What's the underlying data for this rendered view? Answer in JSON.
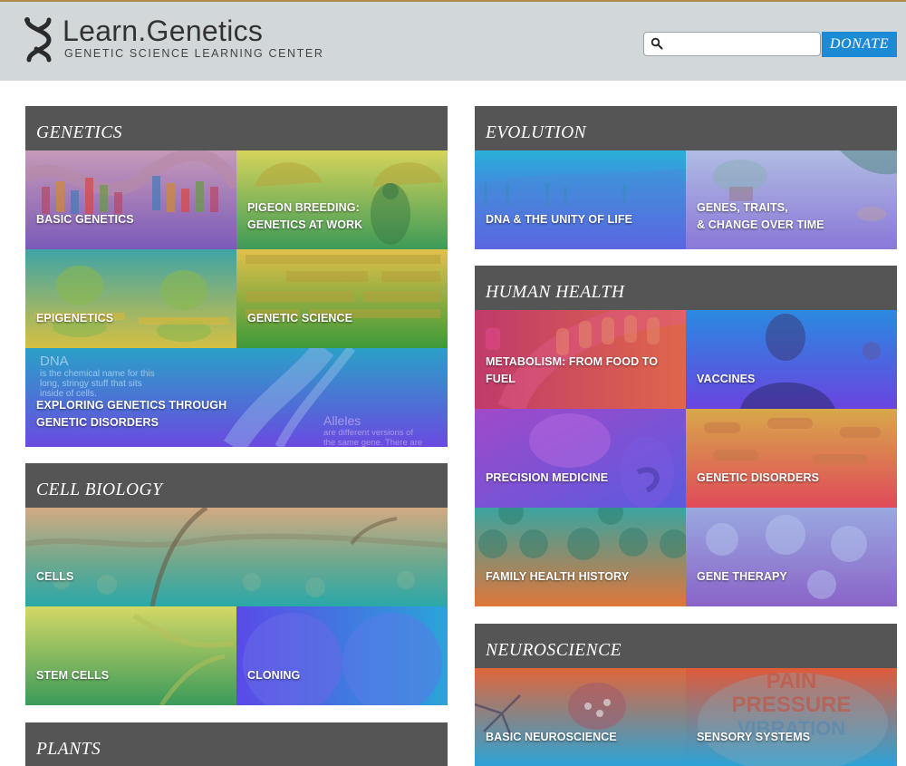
{
  "header": {
    "title": "Learn.Genetics",
    "subtitle": "GENETIC SCIENCE LEARNING CENTER",
    "search_placeholder": "",
    "search_icon": "search-icon",
    "donate_label": "DONATE",
    "colors": {
      "header_bg": "#d2d8da",
      "donate_bg": "#1d8ad6",
      "section_head_bg": "#555555"
    }
  },
  "sections": {
    "genetics": {
      "title": "GENETICS",
      "tiles": [
        {
          "line1": "BASIC GENETICS"
        },
        {
          "line1": "PIGEON BREEDING:",
          "line2": "GENETICS AT WORK"
        },
        {
          "line1": "EPIGENETICS"
        },
        {
          "line1": "GENETIC SCIENCE"
        },
        {
          "line1": "EXPLORING GENETICS THROUGH",
          "line2": "GENETIC DISORDERS",
          "art_text": {
            "dna_title": "DNA",
            "dna_line1": "is the chemical name for this",
            "dna_line2": "long, stringy stuff that sits",
            "dna_line3": "inside of cells.",
            "alleles_title": "Alleles",
            "alleles_line1": "are different versions of",
            "alleles_line2": "the same gene. There are"
          }
        }
      ]
    },
    "cell_biology": {
      "title": "CELL BIOLOGY",
      "tiles": [
        {
          "line1": "CELLS"
        },
        {
          "line1": "STEM CELLS"
        },
        {
          "line1": "CLONING"
        }
      ]
    },
    "plants": {
      "title": "PLANTS"
    },
    "evolution": {
      "title": "EVOLUTION",
      "tiles": [
        {
          "line1": "DNA & THE UNITY OF LIFE"
        },
        {
          "line1": "GENES, TRAITS,",
          "line2": "& CHANGE OVER TIME"
        }
      ]
    },
    "human_health": {
      "title": "HUMAN HEALTH",
      "tiles": [
        {
          "line1": "METABOLISM: FROM FOOD TO FUEL"
        },
        {
          "line1": "VACCINES"
        },
        {
          "line1": "PRECISION MEDICINE"
        },
        {
          "line1": "GENETIC DISORDERS"
        },
        {
          "line1": "FAMILY HEALTH HISTORY"
        },
        {
          "line1": "GENE THERAPY"
        }
      ]
    },
    "neuroscience": {
      "title": "NEUROSCIENCE",
      "tiles": [
        {
          "line1": "BASIC NEUROSCIENCE"
        },
        {
          "line1": "SENSORY SYSTEMS",
          "art_text": {
            "w1": "PAIN",
            "w2": "PRESSURE",
            "w3": "VIBRATION"
          }
        }
      ]
    }
  }
}
